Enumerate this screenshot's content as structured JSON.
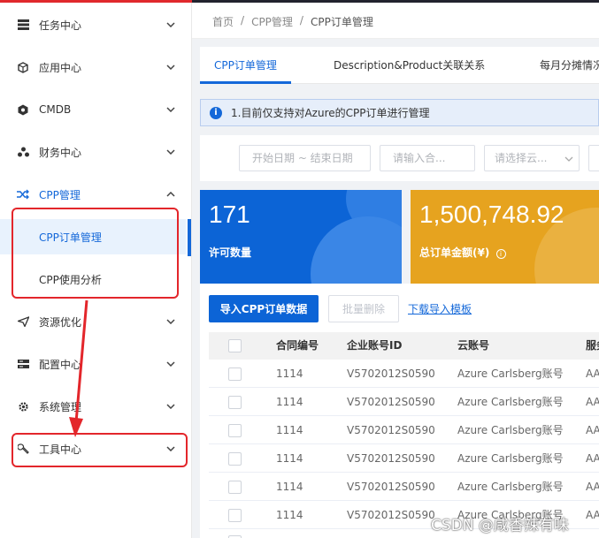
{
  "sidebar": {
    "items": [
      {
        "label": "任务中心",
        "icon": "server-icon"
      },
      {
        "label": "应用中心",
        "icon": "cube-icon"
      },
      {
        "label": "CMDB",
        "icon": "hexagon-icon"
      },
      {
        "label": "财务中心",
        "icon": "cluster-icon"
      },
      {
        "label": "CPP管理",
        "icon": "shuffle-icon"
      },
      {
        "label": "资源优化",
        "icon": "plane-icon"
      },
      {
        "label": "配置中心",
        "icon": "config-icon"
      },
      {
        "label": "系统管理",
        "icon": "gear-icon"
      },
      {
        "label": "工具中心",
        "icon": "wrench-icon"
      }
    ],
    "sub_items": [
      {
        "label": "CPP订单管理"
      },
      {
        "label": "CPP使用分析"
      }
    ]
  },
  "breadcrumb": {
    "home": "首页",
    "sep": "/",
    "section": "CPP管理",
    "current": "CPP订单管理"
  },
  "tabs": [
    "CPP订单管理",
    "Description&Product关联关系",
    "每月分摊情况"
  ],
  "notice": {
    "icon": "info-icon",
    "text": "1.目前仅支持对Azure的CPP订单进行管理"
  },
  "filters": {
    "date_placeholder": "开始日期 ~ 结束日期",
    "contract_placeholder": "请输入合...",
    "cloud_placeholder": "请选择云..."
  },
  "stats": {
    "license_count": "171",
    "license_label": "许可数量",
    "order_total": "1,500,748.92",
    "order_total_label": "总订单金额(¥)"
  },
  "actions": {
    "import": "导入CPP订单数据",
    "batch_delete": "批量删除",
    "download_template": "下载导入模板"
  },
  "table": {
    "columns": [
      "合同编号",
      "企业账号ID",
      "云账号",
      "服务"
    ],
    "rows": [
      {
        "contract": "1114",
        "enterprise_id": "V5702012S0590",
        "cloud_account": "Azure Carlsberg账号",
        "service": "AA"
      },
      {
        "contract": "1114",
        "enterprise_id": "V5702012S0590",
        "cloud_account": "Azure Carlsberg账号",
        "service": "AA"
      },
      {
        "contract": "1114",
        "enterprise_id": "V5702012S0590",
        "cloud_account": "Azure Carlsberg账号",
        "service": "AA"
      },
      {
        "contract": "1114",
        "enterprise_id": "V5702012S0590",
        "cloud_account": "Azure Carlsberg账号",
        "service": "AA"
      },
      {
        "contract": "1114",
        "enterprise_id": "V5702012S0590",
        "cloud_account": "Azure Carlsberg账号",
        "service": "AA"
      },
      {
        "contract": "1114",
        "enterprise_id": "V5702012S0590",
        "cloud_account": "Azure Carlsberg账号",
        "service": "AA"
      }
    ]
  },
  "watermark": "CSDN @咸香辣有味",
  "colors": {
    "accent": "#1468d9",
    "card_blue": "#0c64d6",
    "card_gold": "#e6a31f",
    "annotation": "#e3262b"
  }
}
